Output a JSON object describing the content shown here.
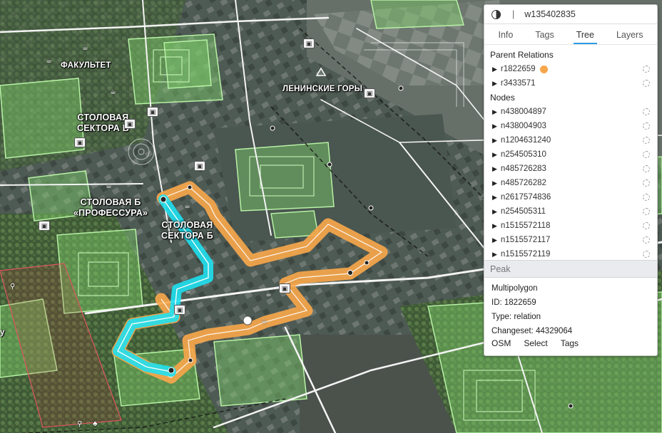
{
  "map": {
    "labels": {
      "fakultet": "ФАКУЛЬТЕТ",
      "leninskie_gory": "ЛЕНИНСКИЕ ГОРЫ",
      "stolovaya_v_1": "СТОЛОВАЯ",
      "stolovaya_v_2": "СЕКТОРА В",
      "stolovaya_b_prof_1": "СТОЛОВАЯ Б",
      "stolovaya_b_prof_2": "«ПРОФЕССУРА»",
      "stolovaya_sb_1": "СТОЛОВАЯ",
      "stolovaya_sb_2": "СЕКТОРА Б",
      "edge_left": "у"
    },
    "colors": {
      "selection": "#f6a64b",
      "highlight": "#1fe0f0",
      "park": "#7ecf6a"
    }
  },
  "panel": {
    "entity_id": "w135402835",
    "tabs": [
      "Info",
      "Tags",
      "Tree",
      "Layers"
    ],
    "active_tab": "Tree",
    "parent_relations_title": "Parent Relations",
    "parent_relations": [
      "r1822659",
      "r3433571"
    ],
    "nodes_title": "Nodes",
    "nodes": [
      "n438004897",
      "n438004903",
      "n1204631240",
      "n254505310",
      "n485726283",
      "n485726282",
      "n2617574836",
      "n254505311",
      "n1515572118",
      "n1515572117",
      "n1515572119"
    ],
    "peak_title": "Peak",
    "peak": {
      "type_name": "Multipolygon",
      "id_line": "ID: 1822659",
      "type_line": "Type: relation",
      "changeset_line": "Changeset: 44329064",
      "links": [
        "OSM",
        "Select",
        "Tags"
      ]
    }
  }
}
